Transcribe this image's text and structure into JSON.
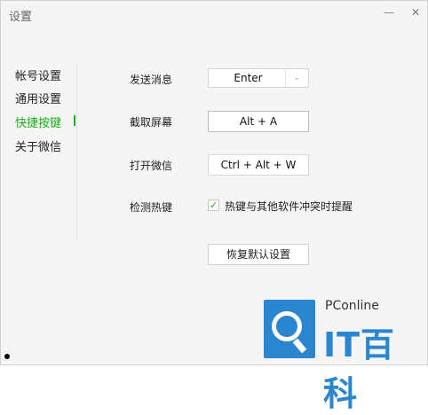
{
  "window": {
    "title": "设置",
    "minimize_glyph": "—",
    "close_glyph": "✕"
  },
  "sidebar": {
    "items": [
      {
        "label": "帐号设置",
        "active": false
      },
      {
        "label": "通用设置",
        "active": false
      },
      {
        "label": "快捷按键",
        "active": true
      },
      {
        "label": "关于微信",
        "active": false
      }
    ],
    "accent_color": "#1aad19"
  },
  "shortcuts": {
    "send_message": {
      "label": "发送消息",
      "value": "Enter",
      "dropdown_icon": "chevron-down-icon"
    },
    "screenshot": {
      "label": "截取屏幕",
      "value": "Alt + A"
    },
    "open_wechat": {
      "label": "打开微信",
      "value": "Ctrl + Alt + W"
    },
    "detect_hotkey": {
      "label": "检测热键",
      "checkbox_label": "热键与其他软件冲突时提醒",
      "checked": true
    }
  },
  "restore_button": {
    "label": "恢复默认设置"
  },
  "watermark": {
    "brand_small": "PConline",
    "brand_big": "IT百科",
    "color": "#2a86cf"
  }
}
